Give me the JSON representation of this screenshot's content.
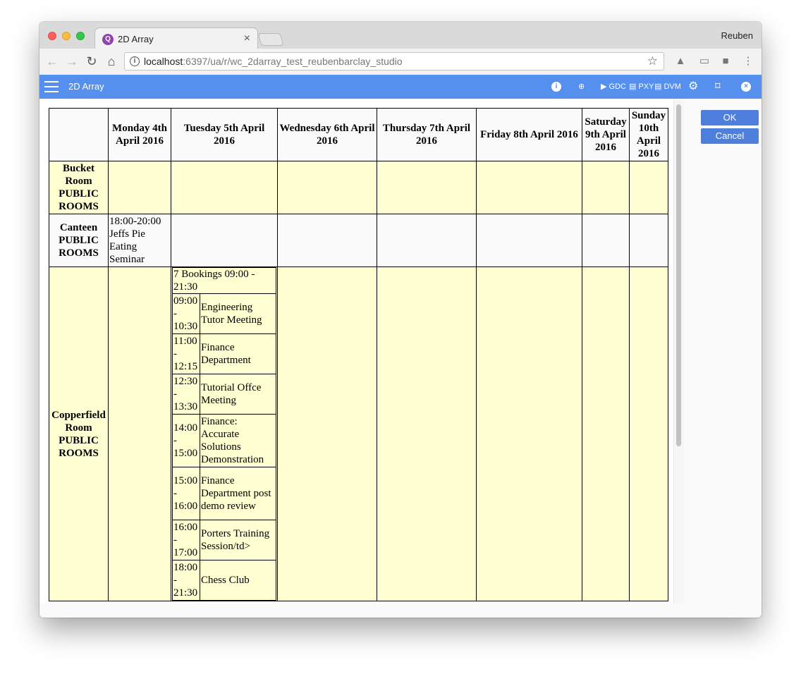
{
  "browser": {
    "tab_title": "2D Array",
    "profile_name": "Reuben",
    "url_host": "localhost",
    "url_rest": ":6397/ua/r/wc_2darray_test_reubenbarclay_studio"
  },
  "appbar": {
    "title": "2D Array",
    "buttons": {
      "gdc": "GDC",
      "pxy": "PXY",
      "dvm": "DVM"
    }
  },
  "actions": {
    "ok": "OK",
    "cancel": "Cancel"
  },
  "grid": {
    "days": [
      "Monday 4th April 2016",
      "Tuesday 5th April 2016",
      "Wednesday 6th April 2016",
      "Thursday 7th April 2016",
      "Friday 8th April 2016",
      "Saturday 9th April 2016",
      "Sunday 10th April 2016"
    ],
    "rooms": [
      {
        "name": "Bucket Room PUBLIC ROOMS"
      },
      {
        "name": "Canteen PUBLIC ROOMS",
        "monday": "18:00-20:00 Jeffs Pie Eating Seminar"
      },
      {
        "name": "Copperfield Room PUBLIC ROOMS",
        "tuesday_summary": "7 Bookings 09:00 - 21:30",
        "tuesday_bookings": [
          {
            "time": "09:00 - 10:30",
            "title": "Engineering Tutor Meeting"
          },
          {
            "time": "11:00 - 12:15",
            "title": "Finance Department"
          },
          {
            "time": "12:30 - 13:30",
            "title": "Tutorial Offce Meeting"
          },
          {
            "time": "14:00 - 15:00",
            "title": "Finance: Accurate Solutions Demonstration"
          },
          {
            "time": "15:00 - 16:00",
            "title": "Finance Department post demo review"
          },
          {
            "time": "16:00 - 17:00",
            "title": "Porters Training Session/td>"
          },
          {
            "time": "18:00 - 21:30",
            "title": "Chess Club"
          }
        ]
      }
    ]
  }
}
